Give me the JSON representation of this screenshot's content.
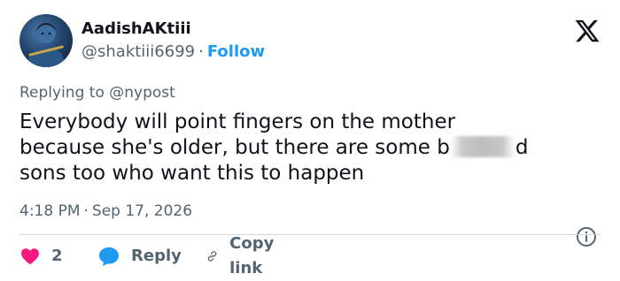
{
  "tweet": {
    "author": {
      "display_name": "AadishAKtiii",
      "handle": "@shaktiii6699",
      "separator": "·",
      "follow_label": "Follow"
    },
    "replying_prefix": "Replying to",
    "replying_to": "@nypost",
    "text_lines": {
      "line1": "Everybody will point fingers on the mother",
      "line2_before": "because she's older, but there are some b",
      "line2_after": "d",
      "line3": "sons too who want this to happen"
    },
    "time": "4:18 PM",
    "date": "Sep 17, 2026",
    "meta_separator": "·"
  },
  "actions": {
    "like_count": "2",
    "reply_label": "Reply",
    "copy_link_label": "Copy link"
  },
  "colors": {
    "text": "#0f1419",
    "secondary": "#536471",
    "link_blue": "#1d9bf0",
    "like_red": "#f91880",
    "divider": "#cfd9de"
  },
  "icons": [
    "x-logo-icon",
    "info-icon",
    "heart-icon",
    "reply-bubble-icon",
    "link-icon"
  ]
}
